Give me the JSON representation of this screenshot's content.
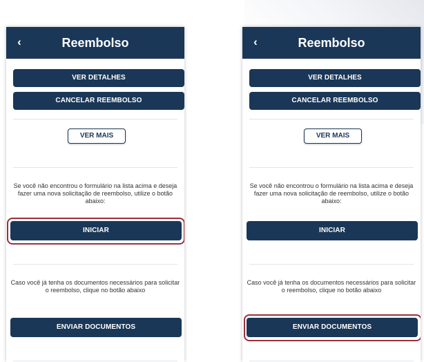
{
  "screens": [
    {
      "header": {
        "back_icon": "‹",
        "title": "Reembolso"
      },
      "buttons": {
        "ver_detalhes": "VER DETALHES",
        "cancelar_reembolso": "CANCELAR REEMBOLSO",
        "ver_mais": "VER MAIS",
        "iniciar": "INICIAR",
        "enviar_documentos": "ENVIAR DOCUMENTOS"
      },
      "messages": {
        "new_request": "Se você não encontrou o formulário na lista acima e deseja fazer uma nova solicitação de reembolso, utilize o botão abaixo:",
        "send_documents": "Caso você já tenha os documentos necessários para solicitar o reembolso, clique no botão abaixo"
      },
      "highlighted_button": "iniciar"
    },
    {
      "header": {
        "back_icon": "‹",
        "title": "Reembolso"
      },
      "buttons": {
        "ver_detalhes": "VER DETALHES",
        "cancelar_reembolso": "CANCELAR REEMBOLSO",
        "ver_mais": "VER MAIS",
        "iniciar": "INICIAR",
        "enviar_documentos": "ENVIAR DOCUMENTOS"
      },
      "messages": {
        "new_request": "Se você não encontrou o formulário na lista acima e deseja fazer uma nova solicitação de reembolso, utilize o botão abaixo:",
        "send_documents": "Caso você já tenha os documentos necessários para solicitar o reembolso, clique no botão abaixo"
      },
      "highlighted_button": "enviar_documentos"
    }
  ],
  "colors": {
    "primary": "#1a3757",
    "highlight": "#9b2f3b",
    "text": "#333333",
    "background": "#ffffff"
  }
}
